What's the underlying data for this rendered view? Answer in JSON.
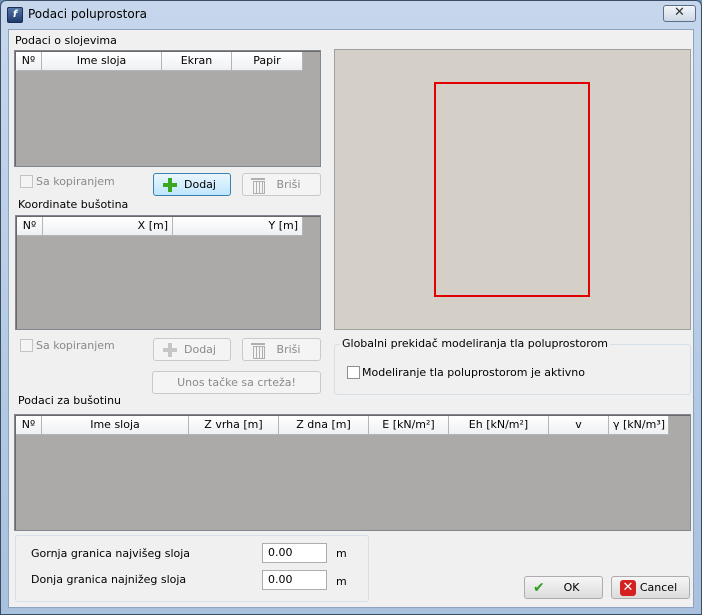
{
  "window": {
    "title": "Podaci poluprostora",
    "close_glyph": "✕"
  },
  "layers_section": {
    "label": "Podaci o slojevima",
    "columns": [
      "Nº",
      "Ime sloja",
      "Ekran",
      "Papir"
    ],
    "copy_checkbox": "Sa kopiranjem",
    "add_label": "Dodaj",
    "delete_label": "Briši"
  },
  "boreholes_section": {
    "label": "Koordinate bušotina",
    "columns": [
      "Nº",
      "X [m]",
      "Y [m]"
    ],
    "copy_checkbox": "Sa kopiranjem",
    "add_label": "Dodaj",
    "delete_label": "Briši",
    "pick_point_label": "Unos tačke sa crteža!"
  },
  "global_group": {
    "title": "Globalni prekidač modeliranja tla poluprostorom",
    "checkbox": "Modeliranje tla poluprostorom je aktivno"
  },
  "borehole_data": {
    "label": "Podaci za bušotinu",
    "columns": [
      "Nº",
      "Ime sloja",
      "Z vrha [m]",
      "Z dna [m]",
      "E [kN/m²]",
      "Eh [kN/m²]",
      "v",
      "γ [kN/m³]"
    ]
  },
  "bounds": {
    "upper_label": "Gornja granica najvišeg sloja",
    "upper_value": "0.00",
    "upper_unit": "m",
    "lower_label": "Donja granica najnižeg sloja",
    "lower_value": "0.00",
    "lower_unit": "m"
  },
  "footer": {
    "ok_label": "OK",
    "cancel_label": "Cancel"
  },
  "colors": {
    "preview_rect": "#e00000",
    "preview_bg": "#d4d0c8"
  }
}
